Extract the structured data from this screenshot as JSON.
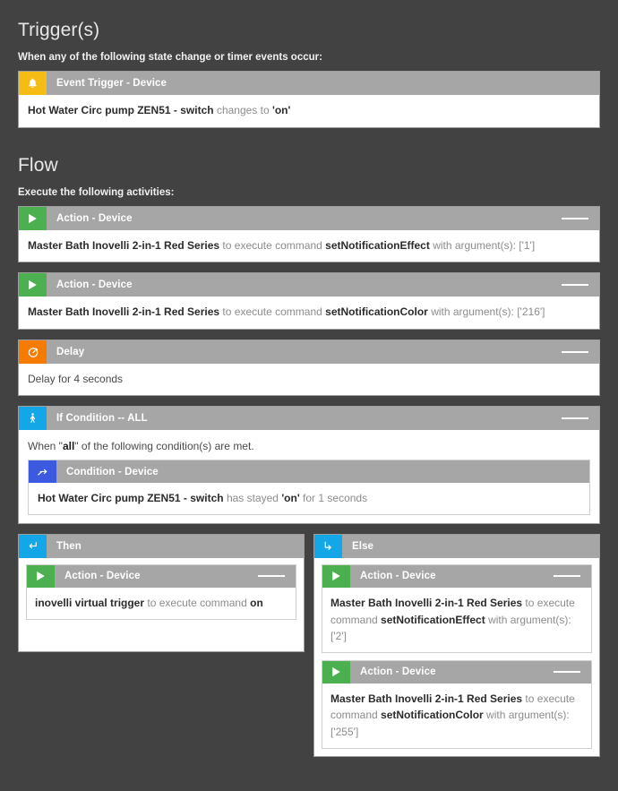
{
  "theme": {
    "background": "#424242",
    "header_bar": "#a6a6a6",
    "card_bg": "#ffffff",
    "amber": "#f5bc16",
    "green": "#4caf50",
    "orange": "#f57c00",
    "cyan": "#14a7e8",
    "indigo": "#3b5ae0"
  },
  "triggers": {
    "title": "Trigger(s)",
    "subtitle": "When any of the following state change or timer events occur:",
    "items": [
      {
        "icon": "bell-icon",
        "icon_color": "amber",
        "head": "Event Trigger - Device",
        "device": "Hot Water Circ pump ZEN51 - switch",
        "predicate": "changes to",
        "value": "'on'",
        "has_handle": false
      }
    ]
  },
  "flow": {
    "title": "Flow",
    "subtitle": "Execute the following activities:",
    "actions": [
      {
        "icon": "play-icon",
        "icon_color": "green",
        "head": "Action - Device",
        "device": "Master Bath Inovelli 2-in-1 Red Series",
        "mid": "to execute command",
        "command": "setNotificationEffect",
        "tail": "with argument(s): ['1']",
        "has_handle": true
      },
      {
        "icon": "play-icon",
        "icon_color": "green",
        "head": "Action - Device",
        "device": "Master Bath Inovelli 2-in-1 Red Series",
        "mid": "to execute command",
        "command": "setNotificationColor",
        "tail": "with argument(s): ['216']",
        "has_handle": true
      }
    ],
    "delay": {
      "icon": "stopwatch-icon",
      "icon_color": "orange",
      "head": "Delay",
      "text": "Delay for 4 seconds",
      "has_handle": true
    },
    "condition": {
      "icon": "person-icon",
      "icon_color": "cyan",
      "head": "If Condition -- ALL",
      "intro_pre": "When \"",
      "intro_strong": "all",
      "intro_post": "\" of the following condition(s) are met.",
      "has_handle": true,
      "inner": {
        "icon": "condition-arrow-icon",
        "icon_color": "indigo",
        "head": "Condition - Device",
        "device": "Hot Water Circ pump ZEN51 - switch",
        "predicate": "has stayed",
        "value": "'on'",
        "tail": "for 1 seconds"
      }
    },
    "then": {
      "icon": "enter-arrow-icon",
      "icon_color": "cyan",
      "head": "Then",
      "actions": [
        {
          "icon": "play-icon",
          "icon_color": "green",
          "head": "Action - Device",
          "device": "inovelli virtual trigger",
          "mid": "to execute command",
          "command": "on",
          "tail": "",
          "has_handle": true
        }
      ]
    },
    "else": {
      "icon": "branch-arrow-icon",
      "icon_color": "cyan",
      "head": "Else",
      "actions": [
        {
          "icon": "play-icon",
          "icon_color": "green",
          "head": "Action - Device",
          "device": "Master Bath Inovelli 2-in-1 Red Series",
          "mid": "to execute command",
          "command": "setNotificationEffect",
          "tail": "with argument(s): ['2']",
          "has_handle": true
        },
        {
          "icon": "play-icon",
          "icon_color": "green",
          "head": "Action - Device",
          "device": "Master Bath Inovelli 2-in-1 Red Series",
          "mid": "to execute command",
          "command": "setNotificationColor",
          "tail": "with argument(s): ['255']",
          "has_handle": true
        }
      ]
    }
  }
}
